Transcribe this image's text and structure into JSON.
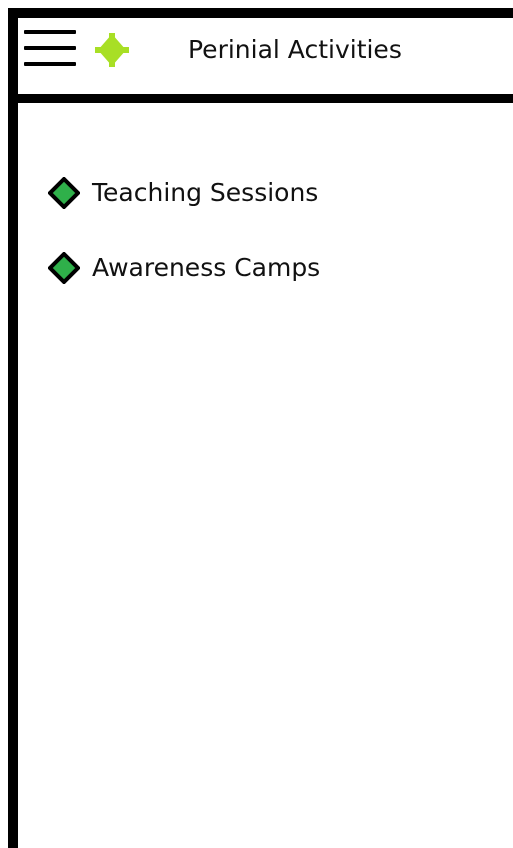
{
  "header": {
    "title": "Perinial Activities",
    "menu_icon": "hamburger-icon",
    "logo_icon": "green-diamond-logo-icon"
  },
  "activities": [
    {
      "label": "Teaching Sessions",
      "icon": "diamond-bullet-icon"
    },
    {
      "label": "Awareness Camps",
      "icon": "diamond-bullet-icon"
    }
  ],
  "colors": {
    "frame_border": "#000000",
    "background": "#ffffff",
    "logo_green": "#a8df25",
    "bullet_green": "#2fb04a",
    "text": "#111111"
  }
}
